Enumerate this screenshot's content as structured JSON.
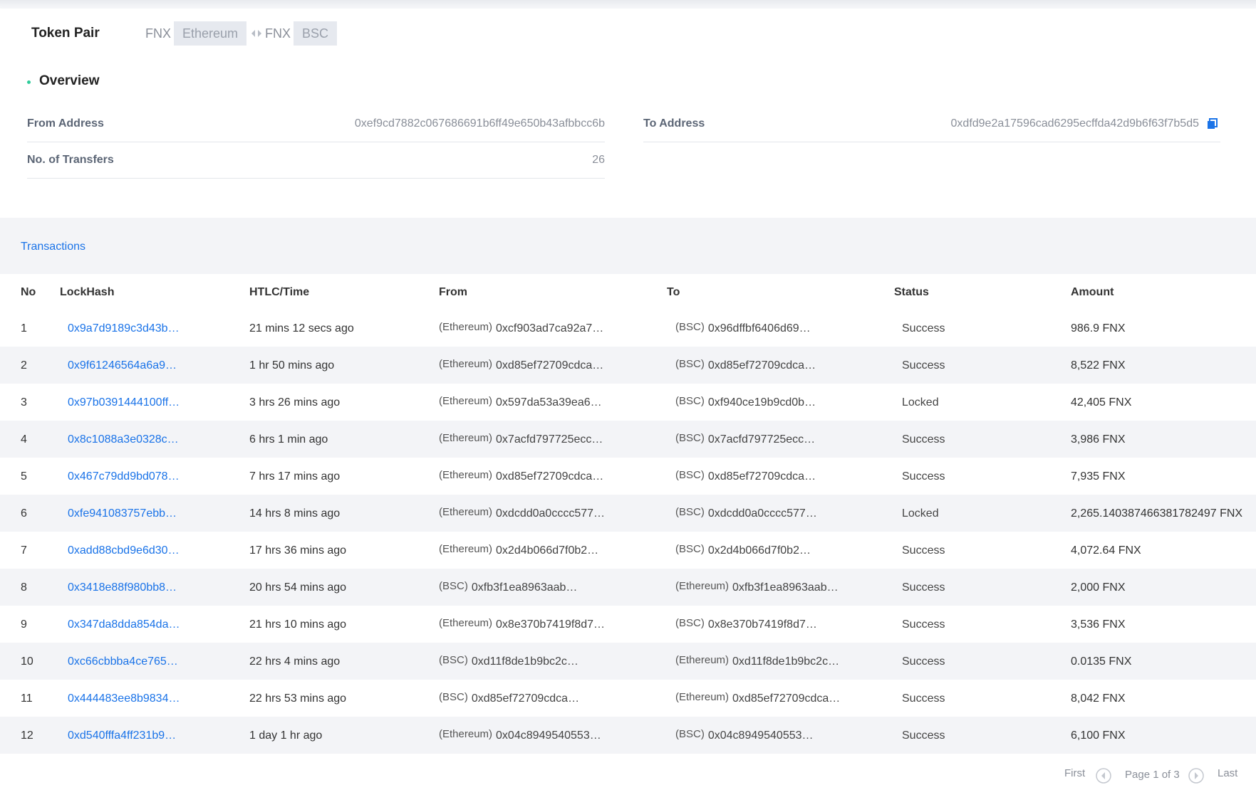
{
  "header": {
    "title": "Token Pair",
    "pair": {
      "from_token": "FNX",
      "from_network": "Ethereum",
      "to_token": "FNX",
      "to_network": "BSC"
    }
  },
  "overview": {
    "title": "Overview",
    "from_address_label": "From Address",
    "from_address": "0xef9cd7882c067686691b6ff49e650b43afbbcc6b",
    "to_address_label": "To Address",
    "to_address": "0xdfd9e2a17596cad6295ecffda42d9b6f63f7b5d5",
    "transfers_label": "No. of Transfers",
    "transfers": "26"
  },
  "transactions": {
    "title": "Transactions",
    "columns": [
      "No",
      "LockHash",
      "HTLC/Time",
      "From",
      "To",
      "Status",
      "Amount"
    ],
    "rows": [
      {
        "no": "1",
        "hash": "0x9a7d9189c3d43b…",
        "time": "21 mins 12 secs ago",
        "from_net": "(Ethereum)",
        "from_addr": "0xcf903ad7ca92a7…",
        "to_net": "(BSC)",
        "to_addr": "0x96dffbf6406d69…",
        "status": "Success",
        "amount": "986.9 FNX"
      },
      {
        "no": "2",
        "hash": "0x9f61246564a6a9…",
        "time": "1 hr 50 mins ago",
        "from_net": "(Ethereum)",
        "from_addr": "0xd85ef72709cdca…",
        "to_net": "(BSC)",
        "to_addr": "0xd85ef72709cdca…",
        "status": "Success",
        "amount": "8,522 FNX"
      },
      {
        "no": "3",
        "hash": "0x97b0391444100ff…",
        "time": "3 hrs 26 mins ago",
        "from_net": "(Ethereum)",
        "from_addr": "0x597da53a39ea6…",
        "to_net": "(BSC)",
        "to_addr": "0xf940ce19b9cd0b…",
        "status": "Locked",
        "amount": "42,405 FNX"
      },
      {
        "no": "4",
        "hash": "0x8c1088a3e0328c…",
        "time": "6 hrs 1 min ago",
        "from_net": "(Ethereum)",
        "from_addr": "0x7acfd797725ecc…",
        "to_net": "(BSC)",
        "to_addr": "0x7acfd797725ecc…",
        "status": "Success",
        "amount": "3,986 FNX"
      },
      {
        "no": "5",
        "hash": "0x467c79dd9bd078…",
        "time": "7 hrs 17 mins ago",
        "from_net": "(Ethereum)",
        "from_addr": "0xd85ef72709cdca…",
        "to_net": "(BSC)",
        "to_addr": "0xd85ef72709cdca…",
        "status": "Success",
        "amount": "7,935 FNX"
      },
      {
        "no": "6",
        "hash": "0xfe941083757ebb…",
        "time": "14 hrs 8 mins ago",
        "from_net": "(Ethereum)",
        "from_addr": "0xdcdd0a0cccc577…",
        "to_net": "(BSC)",
        "to_addr": "0xdcdd0a0cccc577…",
        "status": "Locked",
        "amount": "2,265.140387466381782497 FNX"
      },
      {
        "no": "7",
        "hash": "0xadd88cbd9e6d30…",
        "time": "17 hrs 36 mins ago",
        "from_net": "(Ethereum)",
        "from_addr": "0x2d4b066d7f0b2…",
        "to_net": "(BSC)",
        "to_addr": "0x2d4b066d7f0b2…",
        "status": "Success",
        "amount": "4,072.64 FNX"
      },
      {
        "no": "8",
        "hash": "0x3418e88f980bb8…",
        "time": "20 hrs 54 mins ago",
        "from_net": "(BSC)",
        "from_addr": "0xfb3f1ea8963aab…",
        "to_net": "(Ethereum)",
        "to_addr": "0xfb3f1ea8963aab…",
        "status": "Success",
        "amount": "2,000 FNX"
      },
      {
        "no": "9",
        "hash": "0x347da8dda854da…",
        "time": "21 hrs 10 mins ago",
        "from_net": "(Ethereum)",
        "from_addr": "0x8e370b7419f8d7…",
        "to_net": "(BSC)",
        "to_addr": "0x8e370b7419f8d7…",
        "status": "Success",
        "amount": "3,536 FNX"
      },
      {
        "no": "10",
        "hash": "0xc66cbbba4ce765…",
        "time": "22 hrs 4 mins ago",
        "from_net": "(BSC)",
        "from_addr": "0xd11f8de1b9bc2c…",
        "to_net": "(Ethereum)",
        "to_addr": "0xd11f8de1b9bc2c…",
        "status": "Success",
        "amount": "0.0135 FNX"
      },
      {
        "no": "11",
        "hash": "0x444483ee8b9834…",
        "time": "22 hrs 53 mins ago",
        "from_net": "(BSC)",
        "from_addr": "0xd85ef72709cdca…",
        "to_net": "(Ethereum)",
        "to_addr": "0xd85ef72709cdca…",
        "status": "Success",
        "amount": "8,042 FNX"
      },
      {
        "no": "12",
        "hash": "0xd540fffa4ff231b9…",
        "time": "1 day 1 hr ago",
        "from_net": "(Ethereum)",
        "from_addr": "0x04c8949540553…",
        "to_net": "(BSC)",
        "to_addr": "0x04c8949540553…",
        "status": "Success",
        "amount": "6,100 FNX"
      }
    ]
  },
  "pagination": {
    "first": "First",
    "page_text": "Page 1 of 3",
    "last": "Last"
  },
  "colors": {
    "link": "#1a73e8",
    "accent_dot": "#2ecc9a",
    "band": "#f3f4f7"
  },
  "icons": {
    "copy": "copy-icon",
    "swap": "swap-arrows-icon",
    "prev": "prev-page-icon",
    "next": "next-page-icon"
  }
}
